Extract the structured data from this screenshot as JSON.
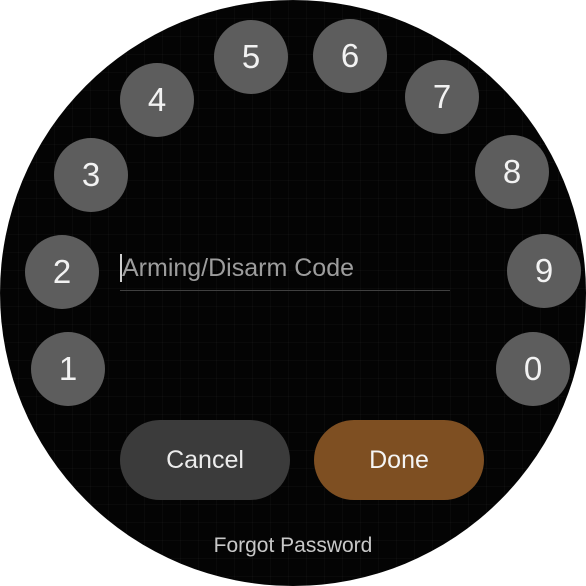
{
  "keypad": {
    "keys": [
      "1",
      "2",
      "3",
      "4",
      "5",
      "6",
      "7",
      "8",
      "9",
      "0"
    ]
  },
  "code_input": {
    "placeholder": "Arming/Disarm Code",
    "value": ""
  },
  "actions": {
    "cancel_label": "Cancel",
    "done_label": "Done",
    "forgot_label": "Forgot Password"
  },
  "colors": {
    "background": "#040404",
    "key_fill": "#5d5d5d",
    "cancel_fill": "#3b3b3b",
    "done_accent": "#7e4f22"
  }
}
